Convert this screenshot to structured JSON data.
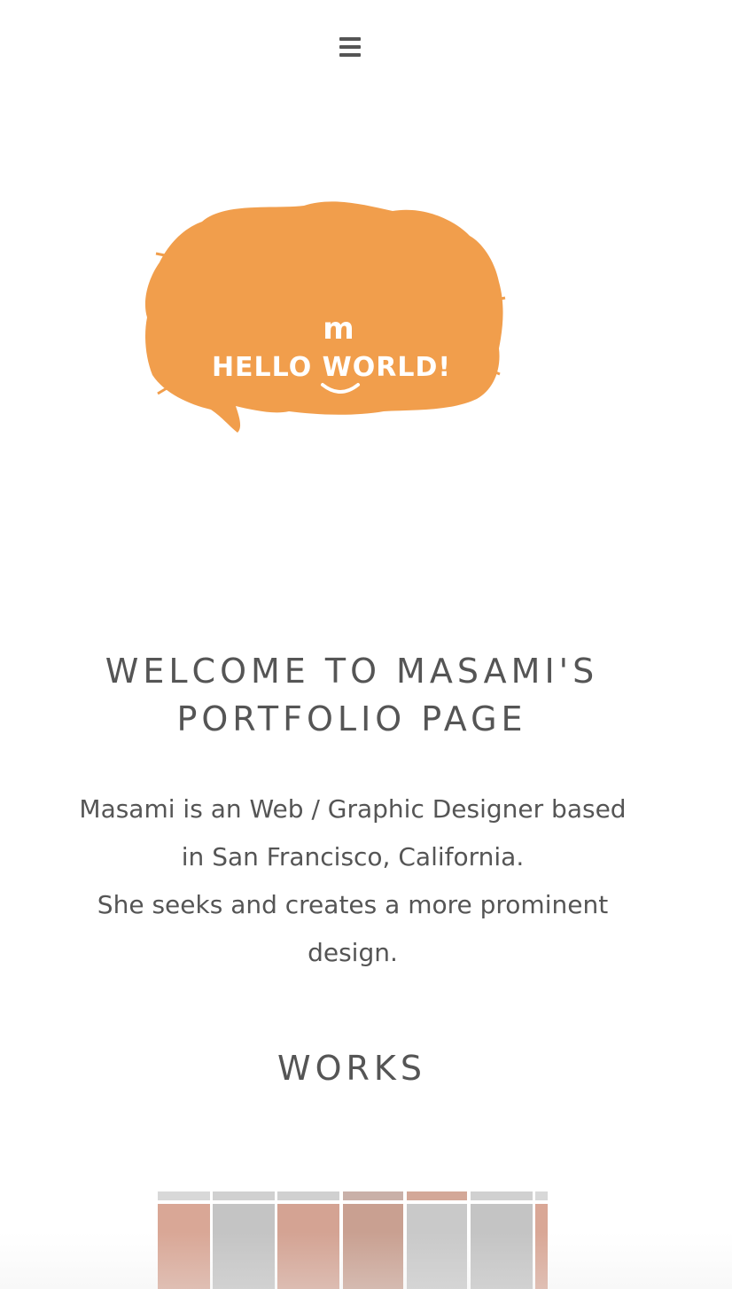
{
  "header": {
    "menu_icon": "hamburger-menu-icon"
  },
  "logo": {
    "initial": "m",
    "text": "HELLO WORLD!",
    "color": "#F19E4C"
  },
  "welcome": {
    "title_line1": "WELCOME TO MASAMI'S",
    "title_line2": "PORTFOLIO PAGE",
    "intro_line1": "Masami is an Web / Graphic Designer based",
    "intro_line2": "in San Francisco, California.",
    "intro_line3": "She seeks and creates a more prominent",
    "intro_line4": "design."
  },
  "works": {
    "title": "WORKS"
  },
  "colors": {
    "text": "#555555",
    "accent": "#F19E4C",
    "thumb_pink": "#D9A796",
    "thumb_gray": "#C4C4C4"
  }
}
